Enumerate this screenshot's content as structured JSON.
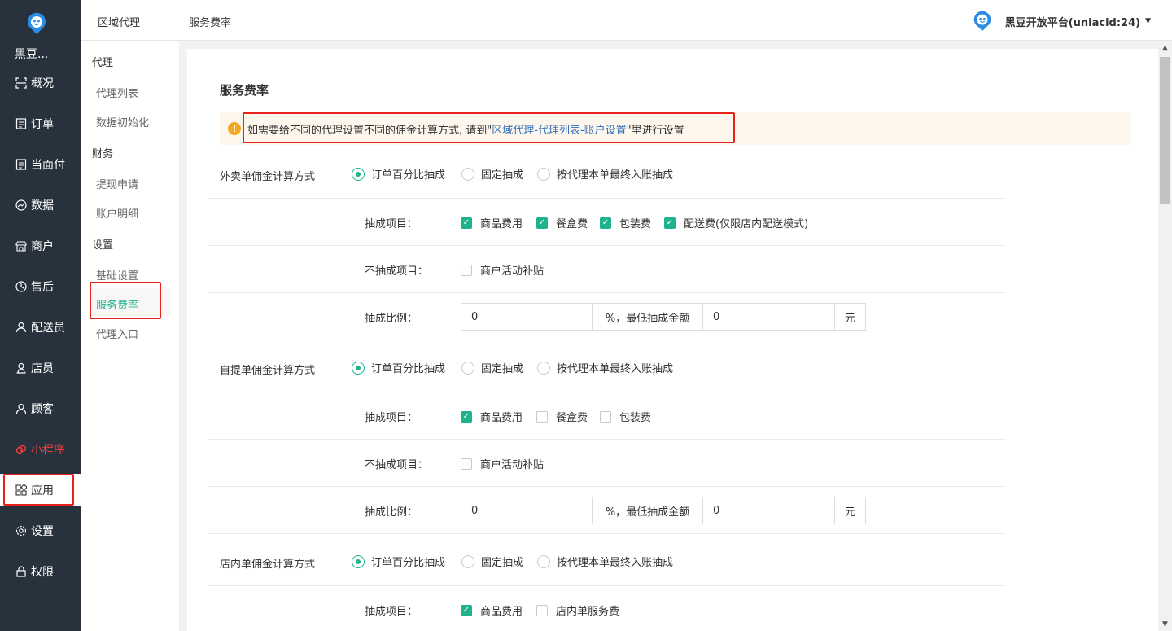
{
  "sidebar": {
    "brand": "黑豆...",
    "items": [
      {
        "label": "概况",
        "icon": "overview-icon"
      },
      {
        "label": "订单",
        "icon": "order-icon"
      },
      {
        "label": "当面付",
        "icon": "pay-icon"
      },
      {
        "label": "数据",
        "icon": "chart-icon"
      },
      {
        "label": "商户",
        "icon": "shop-icon"
      },
      {
        "label": "售后",
        "icon": "service-icon"
      },
      {
        "label": "配送员",
        "icon": "user-icon"
      },
      {
        "label": "店员",
        "icon": "user-icon"
      },
      {
        "label": "顾客",
        "icon": "user-icon"
      },
      {
        "label": "小程序",
        "icon": "mini-program-icon"
      },
      {
        "label": "应用",
        "icon": "apps-icon"
      },
      {
        "label": "设置",
        "icon": "gear-icon"
      },
      {
        "label": "权限",
        "icon": "lock-icon"
      }
    ]
  },
  "subnav": {
    "groups": [
      {
        "title": "代理",
        "links": [
          "代理列表",
          "数据初始化"
        ]
      },
      {
        "title": "财务",
        "links": [
          "提现申请",
          "账户明细"
        ]
      },
      {
        "title": "设置",
        "links": [
          "基础设置",
          "服务费率",
          "代理入口"
        ]
      }
    ]
  },
  "header": {
    "crumb1": "区域代理",
    "crumb2": "服务费率",
    "user": "黑豆开放平台(uniacid:24)"
  },
  "main": {
    "title": "服务费率",
    "notice_pre": "如需要给不同的代理设置不同的佣金计算方式, 请到\"",
    "notice_link": "区域代理-代理列表-账户设置",
    "notice_post": "\"里进行设置",
    "radio_options": [
      "订单百分比抽成",
      "固定抽成",
      "按代理本单最终入账抽成"
    ],
    "label_items": "抽成项目：",
    "label_exclude": "不抽成项目：",
    "label_ratio": "抽成比例：",
    "addon_min": "%，最低抽成金额",
    "addon_yuan": "元",
    "exclude_option": "商户活动补贴",
    "sections": [
      {
        "title": "外卖单佣金计算方式",
        "items": [
          {
            "label": "商品费用",
            "checked": true
          },
          {
            "label": "餐盒费",
            "checked": true
          },
          {
            "label": "包装费",
            "checked": true
          },
          {
            "label": "配送费(仅限店内配送模式)",
            "checked": true
          }
        ],
        "ratio": "0",
        "min": "0"
      },
      {
        "title": "自提单佣金计算方式",
        "items": [
          {
            "label": "商品费用",
            "checked": true
          },
          {
            "label": "餐盒费",
            "checked": false
          },
          {
            "label": "包装费",
            "checked": false
          }
        ],
        "ratio": "0",
        "min": "0"
      },
      {
        "title": "店内单佣金计算方式",
        "items": [
          {
            "label": "商品费用",
            "checked": true
          },
          {
            "label": "店内单服务费",
            "checked": false
          }
        ]
      }
    ]
  },
  "colors": {
    "accent": "#1fb28d",
    "sidebar_bg": "#27323d",
    "highlight_red": "#e8221b",
    "link_blue": "#2f6fba"
  }
}
